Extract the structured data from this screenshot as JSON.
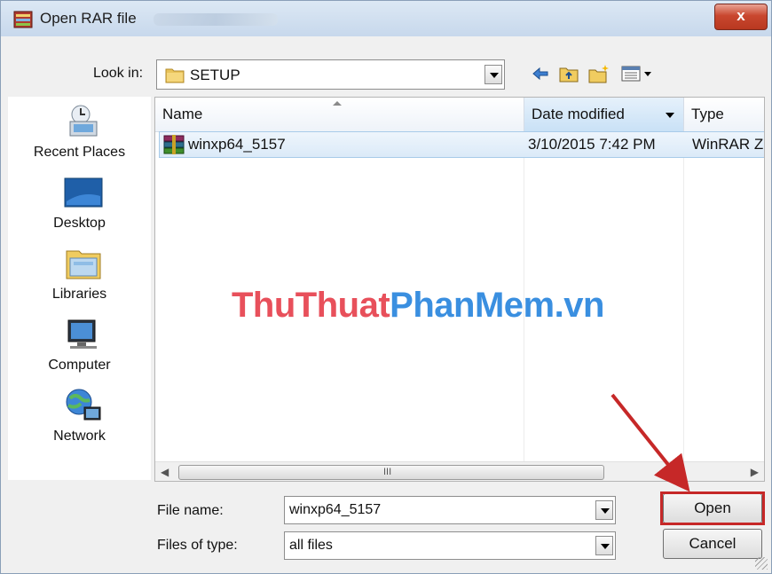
{
  "window": {
    "title": "Open RAR file",
    "close_label": "x"
  },
  "look_in": {
    "label": "Look in:",
    "value": "SETUP"
  },
  "toolbar": {
    "icons": [
      "back-arrow-icon",
      "up-folder-icon",
      "new-folder-icon",
      "view-menu-icon"
    ]
  },
  "places": [
    {
      "label": "Recent Places",
      "icon": "recent-places-icon"
    },
    {
      "label": "Desktop",
      "icon": "desktop-icon"
    },
    {
      "label": "Libraries",
      "icon": "libraries-icon"
    },
    {
      "label": "Computer",
      "icon": "computer-icon"
    },
    {
      "label": "Network",
      "icon": "network-icon"
    }
  ],
  "file_list": {
    "columns": [
      "Name",
      "Date modified",
      "Type"
    ],
    "rows": [
      {
        "name": "winxp64_5157",
        "date_modified": "3/10/2015 7:42 PM",
        "type": "WinRAR Z",
        "icon": "winrar-archive-icon"
      }
    ],
    "scrollbar_grip": "III"
  },
  "watermark": {
    "part1": "ThuThuat",
    "part2": "PhanMem.vn"
  },
  "form": {
    "file_name_label": "File name:",
    "file_name_value": "winxp64_5157",
    "files_of_type_label": "Files of type:",
    "files_of_type_value": "all files"
  },
  "buttons": {
    "open": "Open",
    "cancel": "Cancel"
  },
  "colors": {
    "highlight": "#c62828",
    "watermark_red": "#e8505b",
    "watermark_blue": "#3a8fe0"
  }
}
